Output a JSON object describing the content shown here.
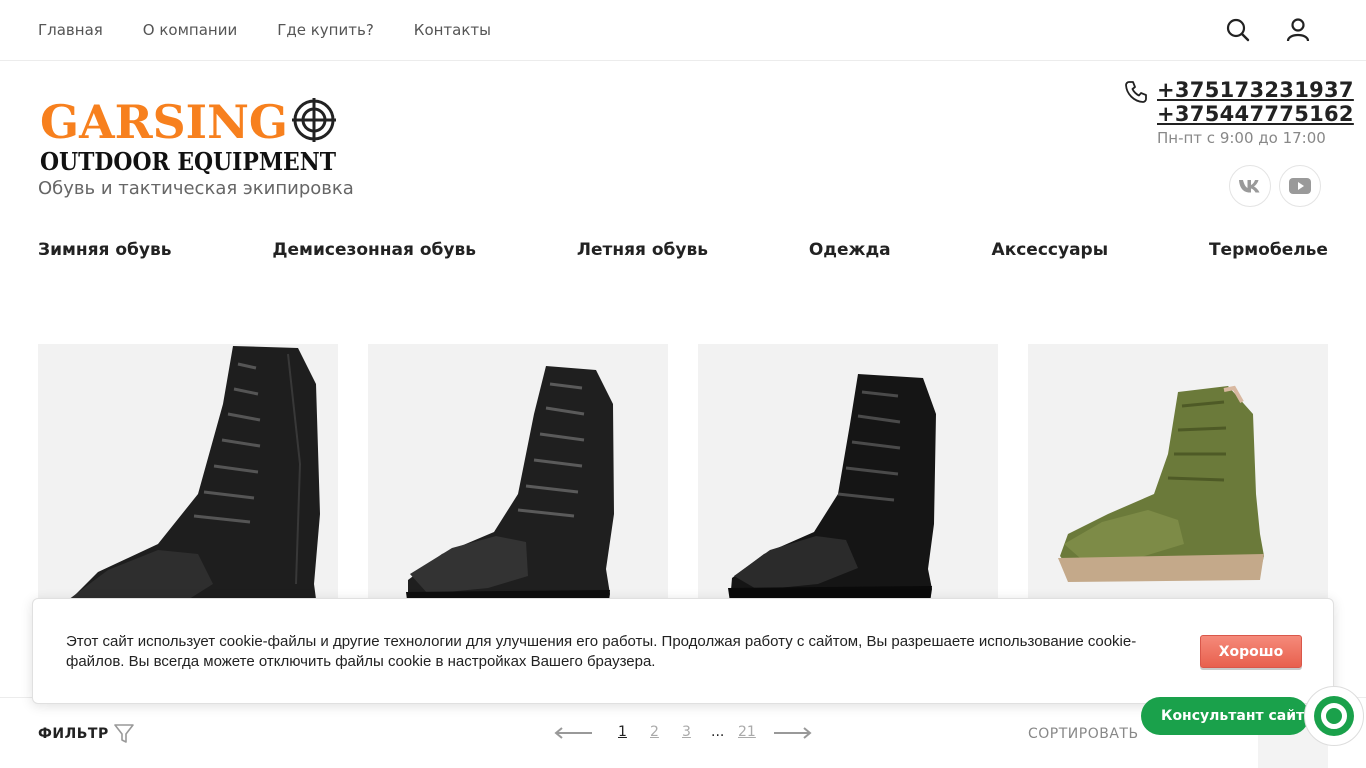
{
  "topnav": {
    "items": [
      "Главная",
      "О компании",
      "Где купить?",
      "Контакты"
    ]
  },
  "icons": {
    "search": "search-icon",
    "user": "user-icon",
    "phone": "phone-icon",
    "vk": "vk-icon",
    "youtube": "youtube-icon",
    "filter": "filter-icon"
  },
  "header": {
    "logo_top": "GARSING",
    "logo_bottom": "OUTDOOR EQUIPMENT",
    "tagline": "Обувь и тактическая экипировка",
    "phone_1": "+375173231937",
    "phone_2": "+375447775162",
    "hours": "Пн-пт с 9:00 до 17:00"
  },
  "catnav": {
    "items": [
      "Зимняя обувь",
      "Демисезонная обувь",
      "Летняя обувь",
      "Одежда",
      "Аксессуары",
      "Термобелье"
    ]
  },
  "cookie": {
    "text": "Этот сайт использует cookie-файлы и другие технологии для улучшения его работы. Продолжая работу с сайтом, Вы разрешаете использование cookie-файлов. Вы всегда можете отключить файлы cookie в настройках Вашего браузера.",
    "button": "Хорошо"
  },
  "bottom": {
    "filter": "ФИЛЬТР",
    "pages": [
      "1",
      "2",
      "3",
      "...",
      "21"
    ],
    "current_page": "1",
    "sort": "СОРТИРОВАТЬ"
  },
  "consultant": {
    "label": "Консультант сайта"
  },
  "colors": {
    "brand_orange": "#f7801e",
    "accent_red": "#e8604e",
    "consultant_green": "#1aa14b"
  }
}
